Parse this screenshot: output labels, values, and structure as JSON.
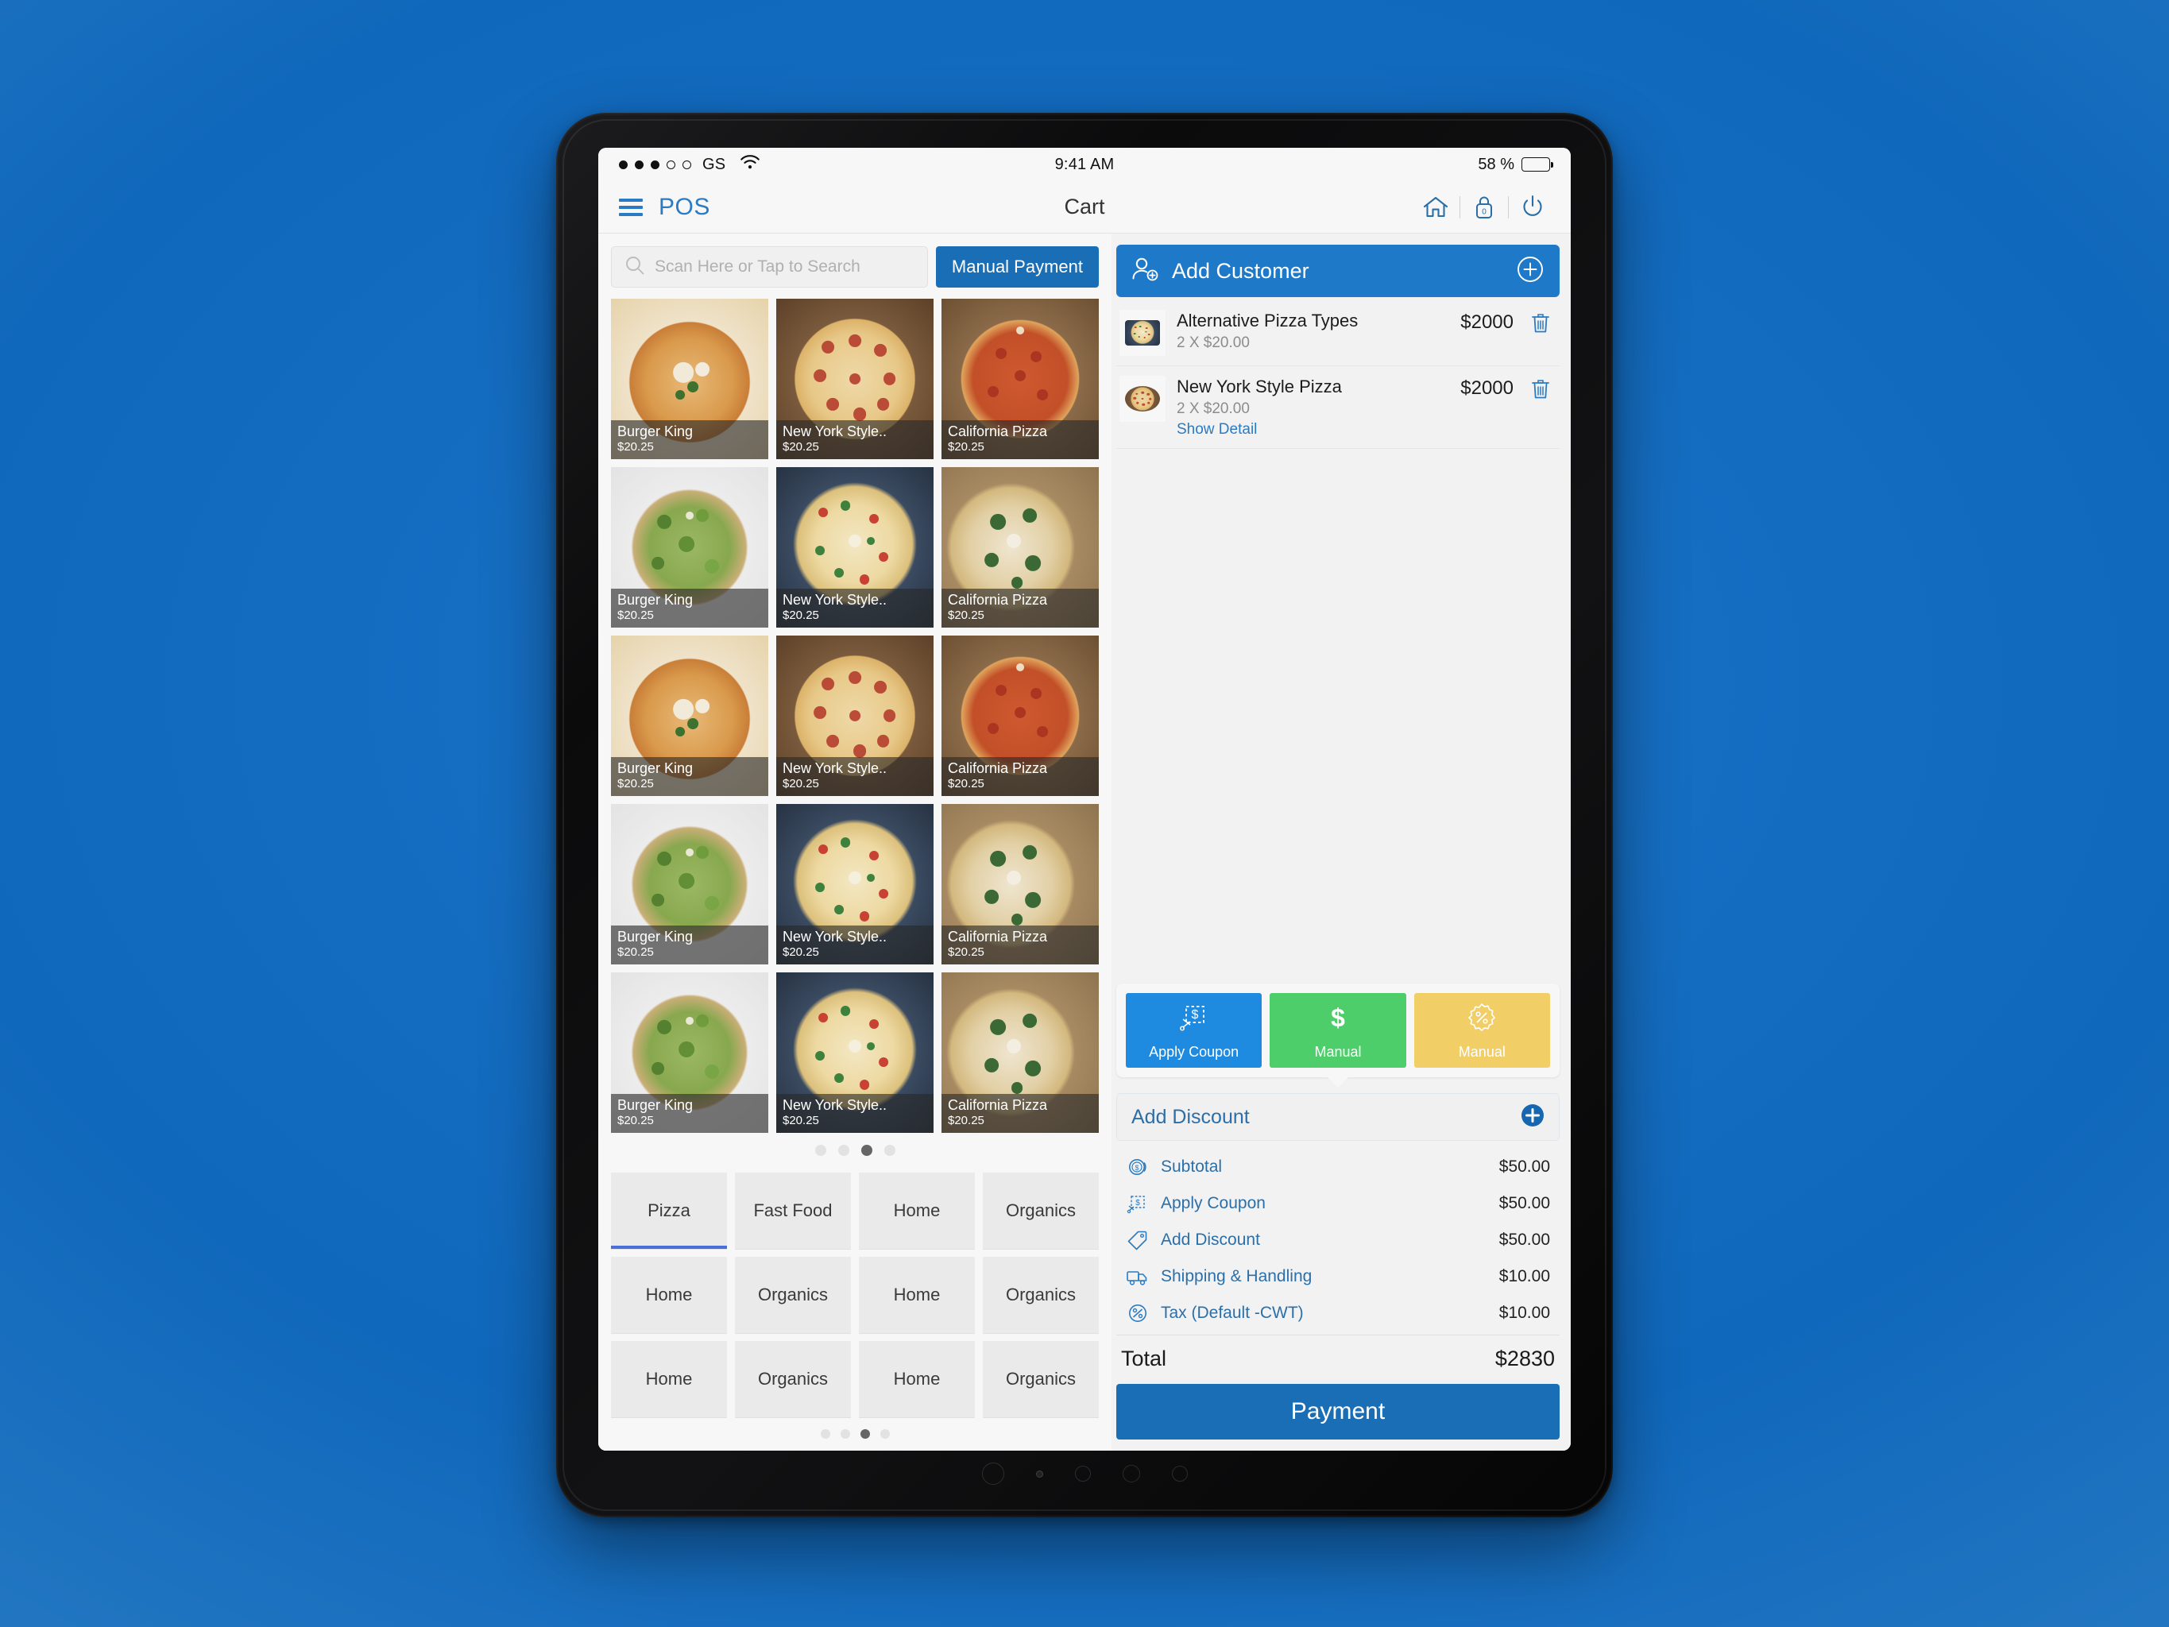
{
  "status_bar": {
    "carrier": "GS",
    "signal_filled": 3,
    "signal_total": 5,
    "wifi_icon": "wifi-icon",
    "time": "9:41 AM",
    "battery_percent": "58 %",
    "battery_level": 58
  },
  "app_bar": {
    "menu_icon": "hamburger-menu-icon",
    "brand": "POS",
    "title": "Cart",
    "actions": [
      {
        "icon": "home-icon",
        "label": ""
      },
      {
        "icon": "lock-icon",
        "label": "0"
      },
      {
        "icon": "power-icon",
        "label": ""
      }
    ]
  },
  "search": {
    "icon": "search-icon",
    "placeholder": "Scan Here or Tap to Search",
    "value": ""
  },
  "manual_payment_button": "Manual Payment",
  "products": [
    {
      "name": "Burger King",
      "price": "$20.25",
      "image": "margherita-pizza"
    },
    {
      "name": "New York Style..",
      "price": "$20.25",
      "image": "pepperoni-pizza"
    },
    {
      "name": "California Pizza",
      "price": "$20.25",
      "image": "sliced-pepperoni-pizza"
    },
    {
      "name": "Burger King",
      "price": "$20.25",
      "image": "arugula-pizza"
    },
    {
      "name": "New York Style..",
      "price": "$20.25",
      "image": "veggie-pizza"
    },
    {
      "name": "California Pizza",
      "price": "$20.25",
      "image": "basil-pizza"
    },
    {
      "name": "Burger King",
      "price": "$20.25",
      "image": "margherita-pizza"
    },
    {
      "name": "New York Style..",
      "price": "$20.25",
      "image": "pepperoni-pizza"
    },
    {
      "name": "California Pizza",
      "price": "$20.25",
      "image": "sliced-pepperoni-pizza"
    },
    {
      "name": "Burger King",
      "price": "$20.25",
      "image": "arugula-pizza"
    },
    {
      "name": "New York Style..",
      "price": "$20.25",
      "image": "veggie-pizza"
    },
    {
      "name": "California Pizza",
      "price": "$20.25",
      "image": "basil-pizza"
    },
    {
      "name": "Burger King",
      "price": "$20.25",
      "image": "arugula-pizza"
    },
    {
      "name": "New York Style..",
      "price": "$20.25",
      "image": "veggie-pizza"
    },
    {
      "name": "California Pizza",
      "price": "$20.25",
      "image": "basil-pizza"
    }
  ],
  "product_pager": {
    "count": 4,
    "active": 3
  },
  "categories": [
    {
      "label": "Pizza",
      "active": true
    },
    {
      "label": "Fast Food",
      "active": false
    },
    {
      "label": "Home",
      "active": false
    },
    {
      "label": "Organics",
      "active": false
    },
    {
      "label": "Home",
      "active": false
    },
    {
      "label": "Organics",
      "active": false
    },
    {
      "label": "Home",
      "active": false
    },
    {
      "label": "Organics",
      "active": false
    },
    {
      "label": "Home",
      "active": false
    },
    {
      "label": "Organics",
      "active": false
    },
    {
      "label": "Home",
      "active": false
    },
    {
      "label": "Organics",
      "active": false
    }
  ],
  "category_pager": {
    "count": 4,
    "active": 3
  },
  "add_customer": {
    "icon": "add-user-icon",
    "label": "Add Customer",
    "plus_icon": "plus-circle-icon"
  },
  "cart_items": [
    {
      "thumb": "pizza-slice-thumb",
      "name": "Alternative Pizza Types",
      "qty_line": "2 X $20.00",
      "price": "$2000",
      "show_detail": null,
      "delete_icon": "trash-icon"
    },
    {
      "thumb": "whole-pizza-thumb",
      "name": "New York Style Pizza",
      "qty_line": "2 X $20.00",
      "price": "$2000",
      "show_detail": "Show Detail",
      "delete_icon": "trash-icon"
    }
  ],
  "action_buttons": [
    {
      "label": "Apply Coupon",
      "icon": "coupon-dollar-icon",
      "color": "#1e8ae0"
    },
    {
      "label": "Manual",
      "icon": "dollar-icon",
      "color": "#4dce6a"
    },
    {
      "label": "Manual",
      "icon": "percent-badge-icon",
      "color": "#f2ce66"
    }
  ],
  "add_discount": {
    "label": "Add Discount",
    "plus_icon": "plus-circle-icon"
  },
  "totals": [
    {
      "icon": "coin-dollar-icon",
      "label": "Subtotal",
      "value": "$50.00"
    },
    {
      "icon": "coupon-dollar-icon",
      "label": "Apply Coupon",
      "value": "$50.00"
    },
    {
      "icon": "price-tag-icon",
      "label": "Add Discount",
      "value": "$50.00"
    },
    {
      "icon": "truck-icon",
      "label": "Shipping & Handling",
      "value": "$10.00"
    },
    {
      "icon": "percent-circle-icon",
      "label": "Tax (Default -CWT)",
      "value": "$10.00"
    }
  ],
  "total": {
    "label": "Total",
    "value": "$2830"
  },
  "payment_button": "Payment",
  "colors": {
    "background": "#1068bc",
    "accent_blue": "#1a6eb5",
    "header_blue": "#2a7bc3",
    "customer_blue": "#1e7ac8",
    "green": "#4dce6a",
    "yellow": "#f2ce66",
    "link_blue": "#2c6fa8"
  }
}
